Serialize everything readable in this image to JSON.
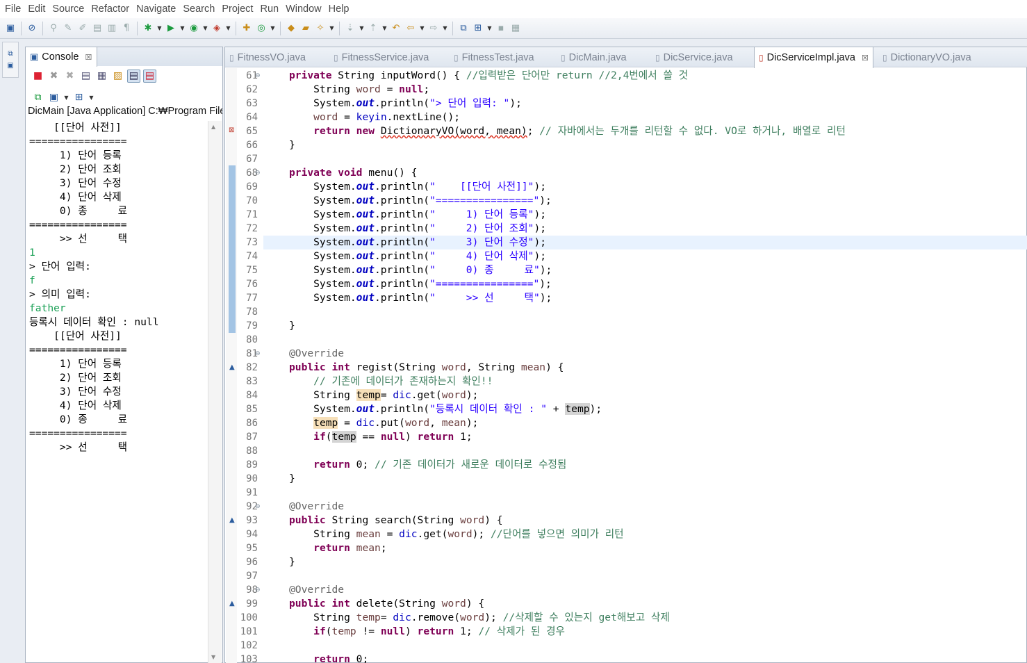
{
  "menu": [
    "File",
    "Edit",
    "Source",
    "Refactor",
    "Navigate",
    "Search",
    "Project",
    "Run",
    "Window",
    "Help"
  ],
  "console": {
    "tab_label": "Console",
    "tab_close": "☒",
    "description": "DicMain [Java Application] C:₩Program Files₩Java₩jdk",
    "output": [
      {
        "text": "    [[단어 사전]]",
        "input": false
      },
      {
        "text": "================",
        "input": false
      },
      {
        "text": "     1) 단어 등록",
        "input": false
      },
      {
        "text": "     2) 단어 조회",
        "input": false
      },
      {
        "text": "     3) 단어 수정",
        "input": false
      },
      {
        "text": "     4) 단어 삭제",
        "input": false
      },
      {
        "text": "     0) 종     료",
        "input": false
      },
      {
        "text": "================",
        "input": false
      },
      {
        "text": "     >> 선     택",
        "input": false
      },
      {
        "text": "1",
        "input": true
      },
      {
        "text": "> 단어 입력: ",
        "input": false
      },
      {
        "text": "f",
        "input": true
      },
      {
        "text": "> 의미 입력: ",
        "input": false
      },
      {
        "text": "father",
        "input": true
      },
      {
        "text": "등록시 데이터 확인 : null",
        "input": false
      },
      {
        "text": "    [[단어 사전]]",
        "input": false
      },
      {
        "text": "================",
        "input": false
      },
      {
        "text": "     1) 단어 등록",
        "input": false
      },
      {
        "text": "     2) 단어 조회",
        "input": false
      },
      {
        "text": "     3) 단어 수정",
        "input": false
      },
      {
        "text": "     4) 단어 삭제",
        "input": false
      },
      {
        "text": "     0) 종     료",
        "input": false
      },
      {
        "text": "================",
        "input": false
      },
      {
        "text": "     >> 선     택",
        "input": false
      }
    ]
  },
  "editor": {
    "tabs": [
      {
        "label": "FitnessVO.java",
        "active": false
      },
      {
        "label": "FitnessService.java",
        "active": false
      },
      {
        "label": "FitnessTest.java",
        "active": false
      },
      {
        "label": "DicMain.java",
        "active": false
      },
      {
        "label": "DicService.java",
        "active": false
      },
      {
        "label": "DicServiceImpl.java",
        "active": true,
        "close": "☒"
      },
      {
        "label": "DictionaryVO.java",
        "active": false
      }
    ],
    "line_numbers": [
      "61",
      "62",
      "63",
      "64",
      "65",
      "66",
      "67",
      "68",
      "69",
      "70",
      "71",
      "72",
      "73",
      "74",
      "75",
      "76",
      "77",
      "78",
      "79",
      "80",
      "81",
      "82",
      "83",
      "84",
      "85",
      "86",
      "87",
      "88",
      "89",
      "90",
      "91",
      "92",
      "93",
      "94",
      "95",
      "96",
      "97",
      "98",
      "99",
      "100",
      "101",
      "102",
      "103"
    ],
    "code_lines": [
      [
        [
          "kw",
          "private "
        ],
        [
          "",
          "String inputWord() { "
        ],
        [
          "cm",
          "//입력받은 단어만 return //2,4번에서 쓸 것"
        ]
      ],
      [
        [
          "",
          "    String "
        ],
        [
          "var",
          "word"
        ],
        [
          "",
          " = "
        ],
        [
          "kw",
          "null"
        ],
        [
          "",
          ";"
        ]
      ],
      [
        [
          "",
          "    System."
        ],
        [
          "sfld",
          "out"
        ],
        [
          "",
          ".println("
        ],
        [
          "st",
          "\"> 단어 입력: \""
        ],
        [
          "",
          ");"
        ]
      ],
      [
        [
          "",
          "    "
        ],
        [
          "var",
          "word"
        ],
        [
          "",
          " = "
        ],
        [
          "fld",
          "keyin"
        ],
        [
          "",
          ".nextLine();"
        ]
      ],
      [
        [
          "",
          "    "
        ],
        [
          "kw",
          "return new "
        ],
        [
          "err",
          "DictionaryVO(word, mean)"
        ],
        [
          "",
          "; "
        ],
        [
          "cm",
          "// 자바에서는 두개를 리턴할 수 없다. VO로 하거나, 배열로 리턴"
        ]
      ],
      [
        [
          "",
          "}"
        ]
      ],
      [
        [
          "",
          ""
        ]
      ],
      [
        [
          "kw",
          "private void "
        ],
        [
          "",
          "menu() {"
        ]
      ],
      [
        [
          "",
          "    System."
        ],
        [
          "sfld",
          "out"
        ],
        [
          "",
          ".println("
        ],
        [
          "st",
          "\"    [[단어 사전]]\""
        ],
        [
          "",
          ");"
        ]
      ],
      [
        [
          "",
          "    System."
        ],
        [
          "sfld",
          "out"
        ],
        [
          "",
          ".println("
        ],
        [
          "st",
          "\"================\""
        ],
        [
          "",
          ");"
        ]
      ],
      [
        [
          "",
          "    System."
        ],
        [
          "sfld",
          "out"
        ],
        [
          "",
          ".println("
        ],
        [
          "st",
          "\"     1) 단어 등록\""
        ],
        [
          "",
          ");"
        ]
      ],
      [
        [
          "",
          "    System."
        ],
        [
          "sfld",
          "out"
        ],
        [
          "",
          ".println("
        ],
        [
          "st",
          "\"     2) 단어 조회\""
        ],
        [
          "",
          ");"
        ]
      ],
      [
        [
          "",
          "    System."
        ],
        [
          "sfld",
          "out"
        ],
        [
          "",
          ".println("
        ],
        [
          "st",
          "\"     3) 단어 수정\""
        ],
        [
          "",
          ");"
        ]
      ],
      [
        [
          "",
          "    System."
        ],
        [
          "sfld",
          "out"
        ],
        [
          "",
          ".println("
        ],
        [
          "st",
          "\"     4) 단어 삭제\""
        ],
        [
          "",
          ");"
        ]
      ],
      [
        [
          "",
          "    System."
        ],
        [
          "sfld",
          "out"
        ],
        [
          "",
          ".println("
        ],
        [
          "st",
          "\"     0) 종     료\""
        ],
        [
          "",
          ");"
        ]
      ],
      [
        [
          "",
          "    System."
        ],
        [
          "sfld",
          "out"
        ],
        [
          "",
          ".println("
        ],
        [
          "st",
          "\"================\""
        ],
        [
          "",
          ");"
        ]
      ],
      [
        [
          "",
          "    System."
        ],
        [
          "sfld",
          "out"
        ],
        [
          "",
          ".println("
        ],
        [
          "st",
          "\"     >> 선     택\""
        ],
        [
          "",
          ");"
        ]
      ],
      [
        [
          "",
          ""
        ]
      ],
      [
        [
          "",
          "}"
        ]
      ],
      [
        [
          "",
          ""
        ]
      ],
      [
        [
          "an",
          "@Override"
        ]
      ],
      [
        [
          "kw",
          "public int "
        ],
        [
          "",
          "regist(String "
        ],
        [
          "var",
          "word"
        ],
        [
          "",
          ", String "
        ],
        [
          "var",
          "mean"
        ],
        [
          "",
          ") {"
        ]
      ],
      [
        [
          "",
          "    "
        ],
        [
          "cm",
          "// 기존에 데이터가 존재하는지 확인!!"
        ]
      ],
      [
        [
          "",
          "    String "
        ],
        [
          "occ",
          "temp"
        ],
        [
          "",
          "= "
        ],
        [
          "fld",
          "dic"
        ],
        [
          "",
          ".get("
        ],
        [
          "var",
          "word"
        ],
        [
          "",
          ");"
        ]
      ],
      [
        [
          "",
          "    System."
        ],
        [
          "sfld",
          "out"
        ],
        [
          "",
          ".println("
        ],
        [
          "st",
          "\"등록시 데이터 확인 : \""
        ],
        [
          "",
          " + "
        ],
        [
          "occ2",
          "temp"
        ],
        [
          "",
          ");"
        ]
      ],
      [
        [
          "",
          "    "
        ],
        [
          "occ",
          "temp"
        ],
        [
          "",
          " = "
        ],
        [
          "fld",
          "dic"
        ],
        [
          "",
          ".put("
        ],
        [
          "var",
          "word"
        ],
        [
          "",
          ", "
        ],
        [
          "var",
          "mean"
        ],
        [
          "",
          ");"
        ]
      ],
      [
        [
          "",
          "    "
        ],
        [
          "kw",
          "if"
        ],
        [
          "",
          "("
        ],
        [
          "occ2",
          "temp"
        ],
        [
          "",
          " == "
        ],
        [
          "kw",
          "null"
        ],
        [
          "",
          ") "
        ],
        [
          "kw",
          "return "
        ],
        [
          "",
          "1;"
        ]
      ],
      [
        [
          "",
          ""
        ]
      ],
      [
        [
          "",
          "    "
        ],
        [
          "kw",
          "return "
        ],
        [
          "",
          "0; "
        ],
        [
          "cm",
          "// 기존 데이터가 새로운 데이터로 수정됨"
        ]
      ],
      [
        [
          "",
          "}"
        ]
      ],
      [
        [
          "",
          ""
        ]
      ],
      [
        [
          "an",
          "@Override"
        ]
      ],
      [
        [
          "kw",
          "public "
        ],
        [
          "",
          "String search(String "
        ],
        [
          "var",
          "word"
        ],
        [
          "",
          ") {"
        ]
      ],
      [
        [
          "",
          "    String "
        ],
        [
          "var",
          "mean"
        ],
        [
          "",
          " = "
        ],
        [
          "fld",
          "dic"
        ],
        [
          "",
          ".get("
        ],
        [
          "var",
          "word"
        ],
        [
          "",
          "); "
        ],
        [
          "cm",
          "//단어를 넣으면 의미가 리턴"
        ]
      ],
      [
        [
          "",
          "    "
        ],
        [
          "kw",
          "return "
        ],
        [
          "var",
          "mean"
        ],
        [
          "",
          ";"
        ]
      ],
      [
        [
          "",
          "}"
        ]
      ],
      [
        [
          "",
          ""
        ]
      ],
      [
        [
          "an",
          "@Override"
        ]
      ],
      [
        [
          "kw",
          "public int "
        ],
        [
          "",
          "delete(String "
        ],
        [
          "var",
          "word"
        ],
        [
          "",
          ") {"
        ]
      ],
      [
        [
          "",
          "    String "
        ],
        [
          "var",
          "temp"
        ],
        [
          "",
          "= "
        ],
        [
          "fld",
          "dic"
        ],
        [
          "",
          ".remove("
        ],
        [
          "var",
          "word"
        ],
        [
          "",
          "); "
        ],
        [
          "cm",
          "//삭제할 수 있는지 get해보고 삭제"
        ]
      ],
      [
        [
          "",
          "    "
        ],
        [
          "kw",
          "if"
        ],
        [
          "",
          "("
        ],
        [
          "var",
          "temp"
        ],
        [
          "",
          " != "
        ],
        [
          "kw",
          "null"
        ],
        [
          "",
          ") "
        ],
        [
          "kw",
          "return "
        ],
        [
          "",
          "1; "
        ],
        [
          "cm",
          "// 삭제가 된 경우"
        ]
      ],
      [
        [
          "",
          ""
        ]
      ],
      [
        [
          "",
          "    "
        ],
        [
          "kw",
          "return "
        ],
        [
          "",
          "0;"
        ]
      ]
    ]
  }
}
